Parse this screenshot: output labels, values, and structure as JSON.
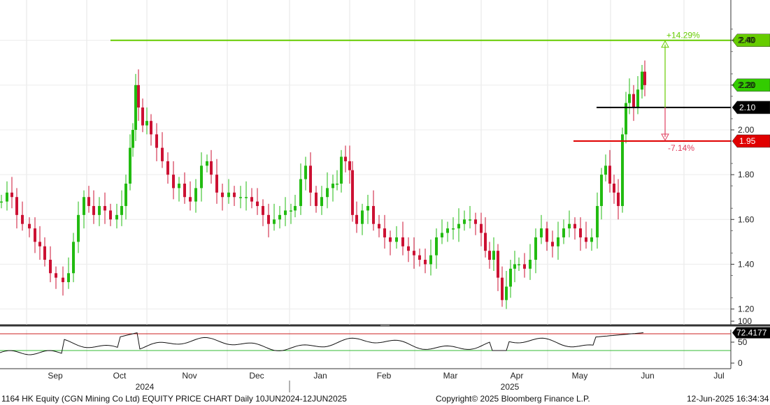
{
  "chart_data": {
    "type": "candlestick",
    "ticker": "1164 HK Equity",
    "x_axis": {
      "months": [
        "Sep",
        "Oct",
        "Nov",
        "Dec",
        "Jan",
        "Feb",
        "Mar",
        "Apr",
        "May",
        "Jun",
        "Jul"
      ],
      "years": [
        "2024",
        "2025"
      ]
    },
    "y_axis": {
      "ticks": [
        "1.20",
        "1.40",
        "1.60",
        "1.80",
        "2.00",
        "2.20",
        "2.40"
      ],
      "ylim": [
        1.13,
        2.58
      ]
    },
    "levels": [
      {
        "value": 2.4,
        "label": "2.40",
        "color": "#66cc00"
      },
      {
        "value": 2.2,
        "label": "2.20",
        "color": "#33cc00"
      },
      {
        "value": 2.1,
        "label": "2.10",
        "color": "#000000"
      },
      {
        "value": 1.95,
        "label": "1.95",
        "color": "#e00000"
      }
    ],
    "annotations": {
      "up_pct": "+14.29%",
      "down_pct": "-7.14%"
    },
    "indicator": {
      "type": "RSI",
      "ticks": [
        "100",
        "50",
        "0"
      ],
      "value": "72.4177",
      "upper": 70,
      "lower": 30
    }
  },
  "footer": {
    "left": "1164 HK Equity (CGN Mining Co Ltd) EQUITY PRICE CHART  Daily 10JUN2024-12JUN2025",
    "center": "Copyright© 2025 Bloomberg Finance L.P.",
    "right": "12-Jun-2025 16:34:34"
  },
  "colors": {
    "up": "#22bb11",
    "down": "#cc1133",
    "accent": "#66cc00"
  }
}
